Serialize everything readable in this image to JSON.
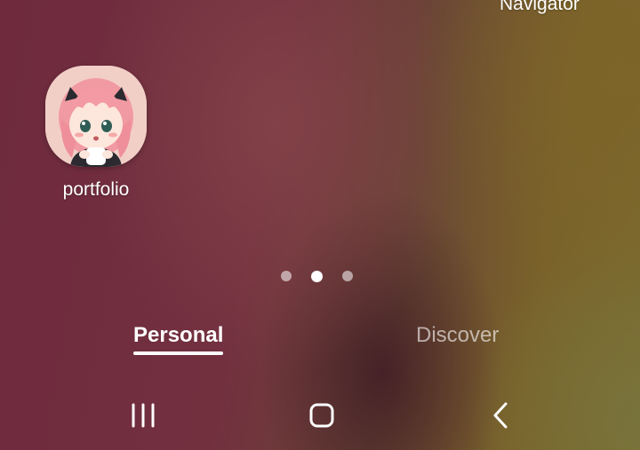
{
  "status": {
    "top_label": "Navigator"
  },
  "home": {
    "apps": [
      {
        "label": "portfolio",
        "icon": "anime-girl-avatar-icon"
      }
    ],
    "page_indicator": {
      "count": 3,
      "active_index": 1
    }
  },
  "tabs": [
    {
      "label": "Personal",
      "active": true
    },
    {
      "label": "Discover",
      "active": false
    }
  ],
  "navigation_bar": {
    "buttons": [
      {
        "name": "recent-apps",
        "icon": "recents-icon"
      },
      {
        "name": "home",
        "icon": "home-icon"
      },
      {
        "name": "back",
        "icon": "back-icon"
      }
    ]
  },
  "colors": {
    "wallpaper_primary": "#6f2a3e",
    "wallpaper_secondary": "#79622a",
    "text": "#ffffff"
  }
}
